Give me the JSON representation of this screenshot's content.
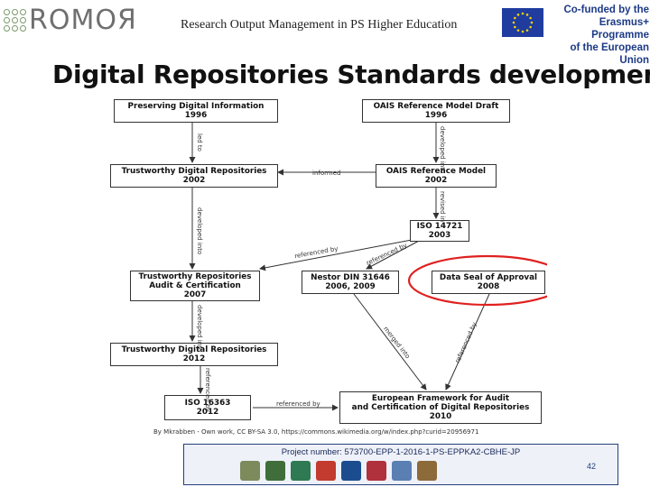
{
  "header": {
    "logo_text": "ROMOЯ",
    "title": "Research Output Management in PS Higher Education",
    "eu_line1": "Co-funded by the",
    "eu_line2": "Erasmus+ Programme",
    "eu_line3": "of the European Union",
    "eu_flag_color": "#1f3c9e",
    "eu_star_color": "#f5d400"
  },
  "slide_title": "Digital Repositories Standards development",
  "diagram": {
    "nodes": {
      "preserving": {
        "title": "Preserving Digital Information",
        "year": "1996"
      },
      "oais_draft": {
        "title": "OAIS Reference Model Draft",
        "year": "1996"
      },
      "tdr_2002": {
        "title": "Trustworthy Digital Repositories",
        "year": "2002"
      },
      "oais_2002": {
        "title": "OAIS Reference Model",
        "year": "2002"
      },
      "iso14721": {
        "title": "ISO 14721",
        "year": "2003"
      },
      "trac": {
        "title": "Trustworthy Repositories",
        "title2": "Audit & Certification",
        "year": "2007"
      },
      "nestor": {
        "title": "Nestor DIN 31646",
        "year": "2006, 2009"
      },
      "dsa": {
        "title": "Data Seal of Approval",
        "year": "2008"
      },
      "tdr_2012": {
        "title": "Trustworthy Digital Repositories",
        "year": "2012"
      },
      "iso16363": {
        "title": "ISO 16363",
        "year": "2012"
      },
      "eframework": {
        "title": "European Framework for Audit",
        "title2": "and Certification of Digital Repositories",
        "year": "2010"
      }
    },
    "edge_labels": {
      "led_to": "led to",
      "developed_into_1": "developed into",
      "informed": "informed",
      "revised_in": "revised in",
      "developed_into_2": "developed into",
      "referenced_by_1": "referenced by",
      "referenced_by_2": "referenced by",
      "developed_into_3": "developed into",
      "merged_into": "merged into",
      "referenced_by_3": "referenced by",
      "referenced_by_4": "referenced by",
      "referenced_by_5": "referenced by"
    },
    "highlight_color": "#e02020"
  },
  "caption": "By Mkrabben - Own work, CC BY-SA 3.0, https://commons.wikimedia.org/w/index.php?curid=20956971",
  "footer": {
    "project_number": "Project number: 573700-EPP-1-2016-1-PS-EPPKA2-CBHE-JP",
    "page_number": "42"
  }
}
